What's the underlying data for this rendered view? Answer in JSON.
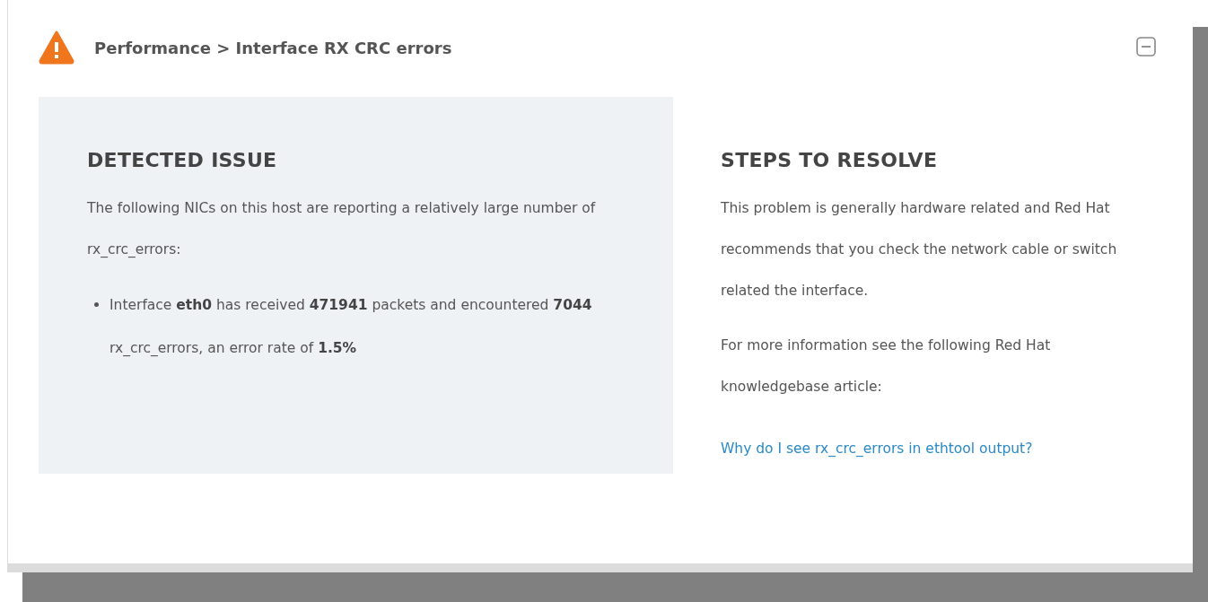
{
  "card": {
    "title": "Performance > Interface RX CRC errors"
  },
  "detected_issue": {
    "heading": "DETECTED ISSUE",
    "intro": "The following NICs on this host are reporting a relatively large number of rx_crc_errors:",
    "items": [
      "Interface **eth0** has received **471941** packets and encountered **7044** rx_crc_errors, an error rate of **1.5%**"
    ]
  },
  "steps_to_resolve": {
    "heading": "STEPS TO RESOLVE",
    "paragraphs": [
      "This problem is generally hardware related and Red Hat recommends that you check the network cable or switch related the interface.",
      "For more information see the following Red Hat knowledgebase article:"
    ],
    "link": "Why do I see rx_crc_errors in ethtool output?"
  }
}
